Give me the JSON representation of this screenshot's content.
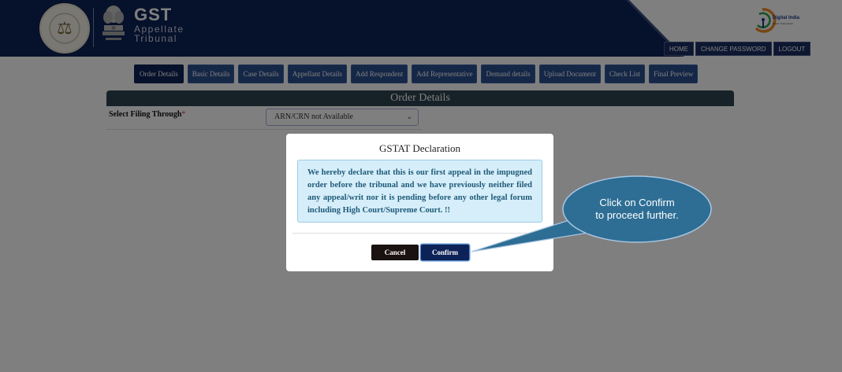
{
  "header": {
    "brand": "GST",
    "brand_sub_1": "Appellate",
    "brand_sub_2": "Tribunal",
    "digital_india": "Digital India",
    "digital_india_sub": "Power To Empower",
    "nav": [
      {
        "label": "HOME"
      },
      {
        "label": "CHANGE PASSWORD"
      },
      {
        "label": "LOGOUT"
      }
    ]
  },
  "tabs": [
    {
      "label": "Order Details",
      "active": true
    },
    {
      "label": "Basic Details"
    },
    {
      "label": "Case Details"
    },
    {
      "label": "Appellant Details"
    },
    {
      "label": "Add Respondent"
    },
    {
      "label": "Add Representative"
    },
    {
      "label": "Demand details"
    },
    {
      "label": "Upload Document"
    },
    {
      "label": "Check List"
    },
    {
      "label": "Final Preview"
    }
  ],
  "section": {
    "title": "Order Details",
    "filing_label": "Select Filing Through",
    "required_mark": "*",
    "filing_value": "ARN/CRN not Available"
  },
  "modal": {
    "title": "GSTAT Declaration",
    "declaration": "We hereby declare that this is our first appeal in the impugned order before the tribunal and we have previously neither filed any appeal/writ nor it is pending before any other legal forum including High Court/Supreme Court. !!",
    "cancel_label": "Cancel",
    "confirm_label": "Confirm"
  },
  "callout": {
    "line1": "Click on Confirm",
    "line2": "to proceed further."
  },
  "colors": {
    "header_navy": "#0d2257",
    "tab_blue": "#2a4f8f",
    "section_bar": "#2f4450",
    "declaration_bg": "#d6eefa",
    "declaration_text": "#1e5a77",
    "callout": "#2e6e94"
  }
}
